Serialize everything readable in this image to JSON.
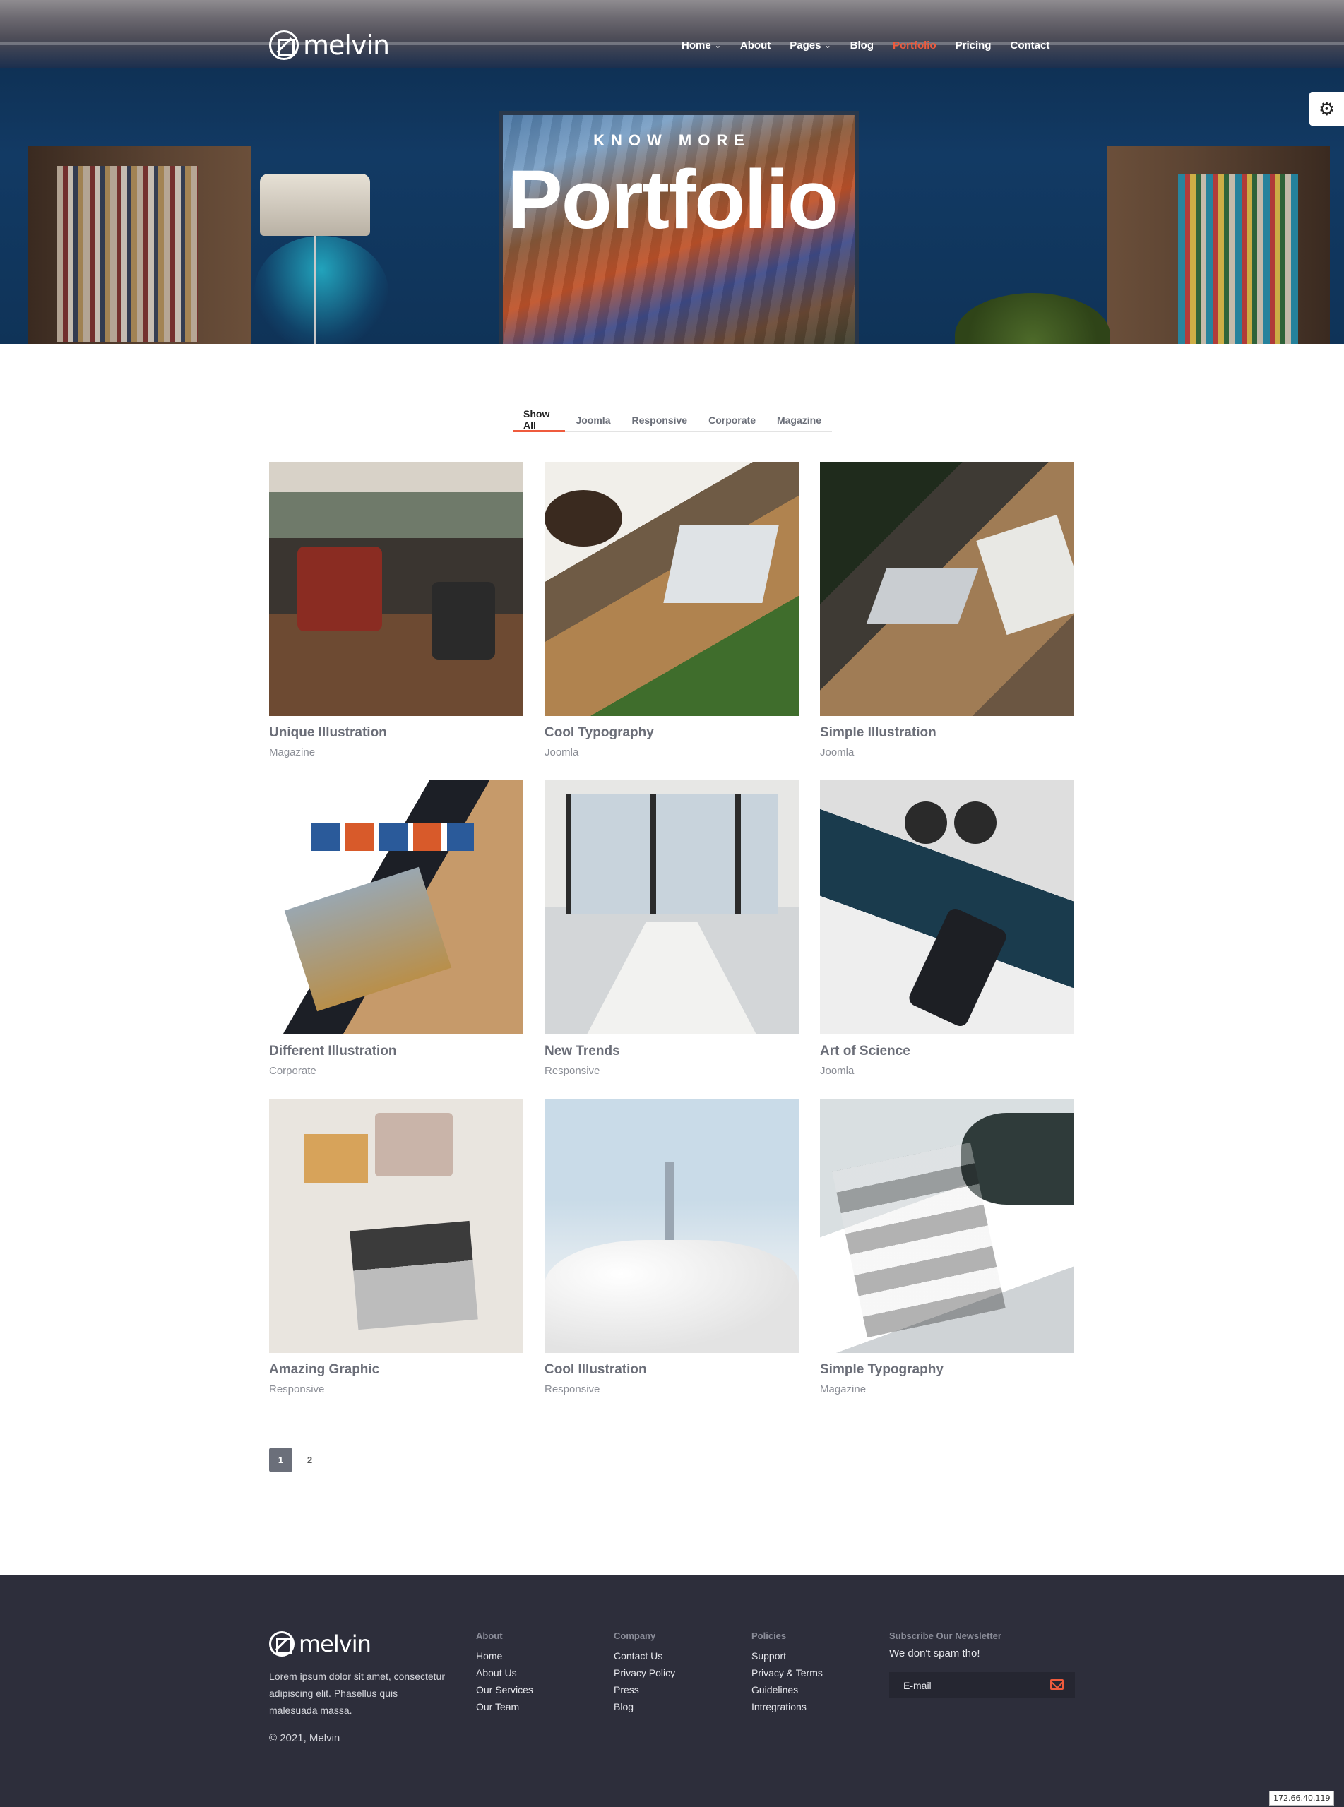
{
  "brand": {
    "name": "melvin"
  },
  "nav": {
    "items": [
      {
        "label": "Home",
        "dropdown": true
      },
      {
        "label": "About",
        "dropdown": false
      },
      {
        "label": "Pages",
        "dropdown": true
      },
      {
        "label": "Blog",
        "dropdown": false
      },
      {
        "label": "Portfolio",
        "dropdown": false,
        "active": true
      },
      {
        "label": "Pricing",
        "dropdown": false
      },
      {
        "label": "Contact",
        "dropdown": false
      }
    ],
    "chevron": "⌄",
    "settings_icon": "⚙"
  },
  "hero": {
    "kicker": "KNOW MORE",
    "title": "Portfolio"
  },
  "filters": {
    "tabs": [
      "Show All",
      "Joomla",
      "Responsive",
      "Corporate",
      "Magazine"
    ],
    "active": "Show All"
  },
  "portfolio": {
    "items": [
      {
        "title": "Unique Illustration",
        "category": "Magazine"
      },
      {
        "title": "Cool Typography",
        "category": "Joomla"
      },
      {
        "title": "Simple Illustration",
        "category": "Joomla"
      },
      {
        "title": "Different Illustration",
        "category": "Corporate"
      },
      {
        "title": "New Trends",
        "category": "Responsive"
      },
      {
        "title": "Art of Science",
        "category": "Joomla"
      },
      {
        "title": "Amazing Graphic",
        "category": "Responsive"
      },
      {
        "title": "Cool Illustration",
        "category": "Responsive"
      },
      {
        "title": "Simple Typography",
        "category": "Magazine"
      }
    ]
  },
  "pagination": {
    "pages": [
      "1",
      "2"
    ],
    "current": "1"
  },
  "footer": {
    "description": "Lorem ipsum dolor sit amet, consectetur adipiscing elit. Phasellus quis malesuada massa.",
    "copyright": "© 2021, Melvin",
    "columns": [
      {
        "heading": "About",
        "links": [
          "Home",
          "About Us",
          "Our Services",
          "Our Team"
        ]
      },
      {
        "heading": "Company",
        "links": [
          "Contact Us",
          "Privacy Policy",
          "Press",
          "Blog"
        ]
      },
      {
        "heading": "Policies",
        "links": [
          "Support",
          "Privacy & Terms",
          "Guidelines",
          "Intregrations"
        ]
      }
    ],
    "newsletter": {
      "heading": "Subscribe Our Newsletter",
      "subtext": "We don't spam tho!",
      "placeholder": "E-mail"
    }
  },
  "ip_address": "172.66.40.119",
  "colors": {
    "accent": "#ef5b3d",
    "footer_bg": "#2d2e3b",
    "title_gray": "#6b6e78"
  }
}
